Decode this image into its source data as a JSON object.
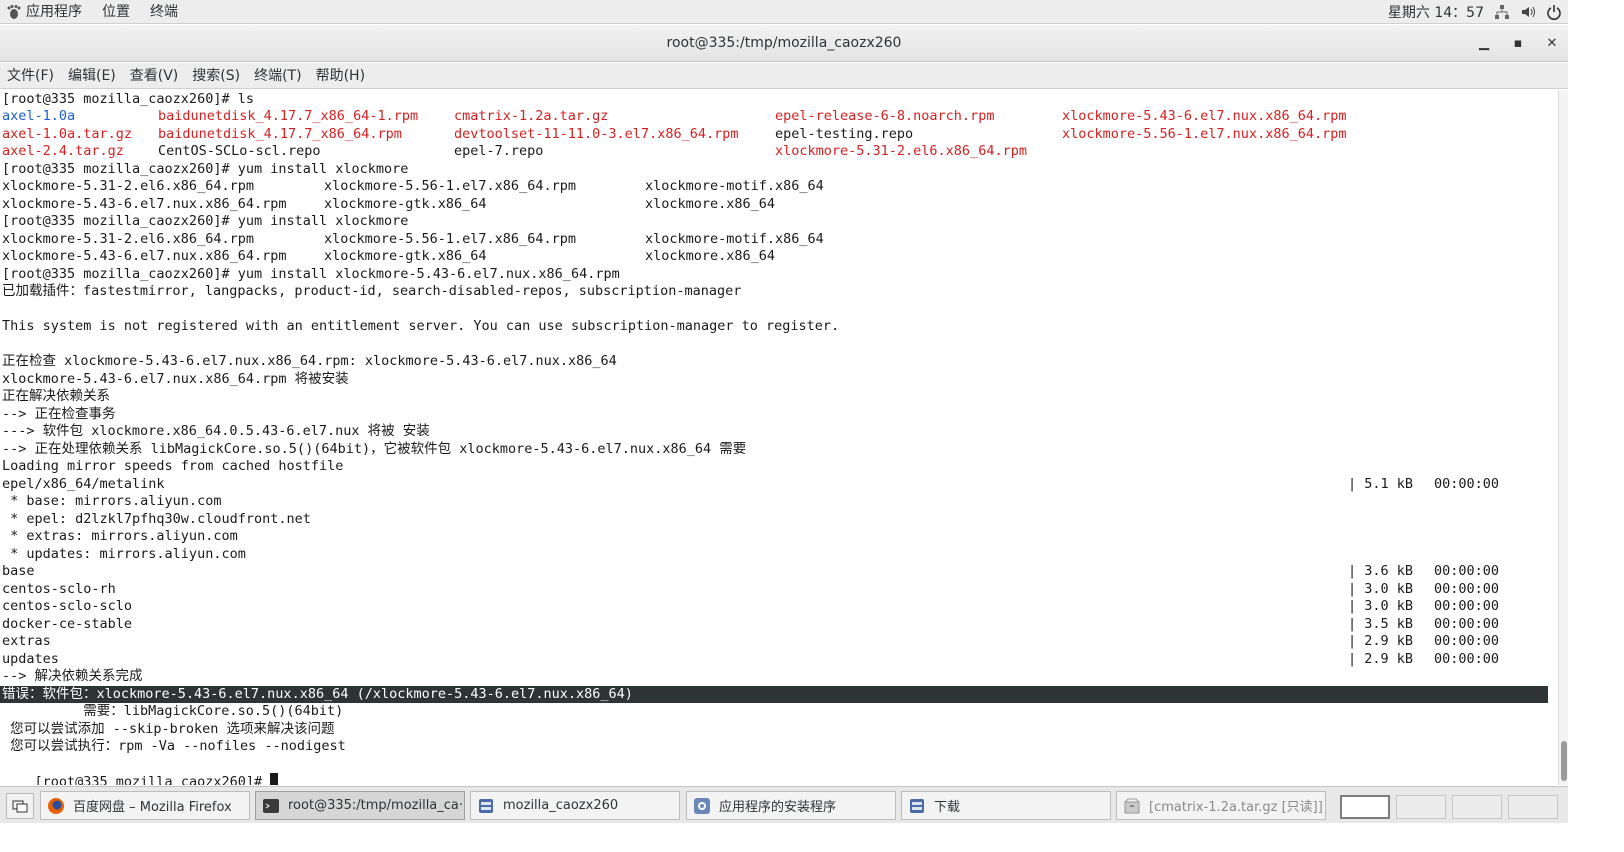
{
  "top_panel": {
    "menu": [
      "应用程序",
      "位置",
      "终端"
    ],
    "clock": "星期六 14：57"
  },
  "window": {
    "title": "root@335:/tmp/mozilla_caozx260",
    "menu": [
      "文件(F)",
      "编辑(E)",
      "查看(V)",
      "搜索(S)",
      "终端(T)",
      "帮助(H)"
    ]
  },
  "terminal": {
    "ls_prompt": "[root@335 mozilla_caozx260]# ls",
    "ls_rows": [
      [
        "axel-1.0a",
        "baidunetdisk_4.17.7_x86_64-1.rpm",
        "cmatrix-1.2a.tar.gz",
        "epel-release-6-8.noarch.rpm",
        "xlockmore-5.43-6.el7.nux.x86_64.rpm"
      ],
      [
        "axel-1.0a.tar.gz",
        "baidunetdisk_4.17.7_x86_64.rpm",
        "devtoolset-11-11.0-3.el7.x86_64.rpm",
        "epel-testing.repo",
        "xlockmore-5.56-1.el7.nux.x86_64.rpm"
      ],
      [
        "axel-2.4.tar.gz",
        "CentOS-SCLo-scl.repo",
        "epel-7.repo",
        "xlockmore-5.31-2.el6.x86_64.rpm",
        ""
      ]
    ],
    "install1_prompt": "[root@335 mozilla_caozx260]# yum install xlockmore",
    "compl_rows": [
      [
        "xlockmore-5.31-2.el6.x86_64.rpm",
        "xlockmore-5.56-1.el7.x86_64.rpm",
        "xlockmore-motif.x86_64"
      ],
      [
        "xlockmore-5.43-6.el7.nux.x86_64.rpm",
        "xlockmore-gtk.x86_64",
        "xlockmore.x86_64"
      ]
    ],
    "install2_prompt": "[root@335 mozilla_caozx260]# yum install xlockmore",
    "install3_prompt": "[root@335 mozilla_caozx260]# yum install xlockmore-5.43-6.el7.nux.x86_64.rpm",
    "out": [
      "已加载插件：fastestmirror, langpacks, product-id, search-disabled-repos, subscription-manager",
      "",
      "This system is not registered with an entitlement server. You can use subscription-manager to register.",
      "",
      "正在检查 xlockmore-5.43-6.el7.nux.x86_64.rpm: xlockmore-5.43-6.el7.nux.x86_64",
      "xlockmore-5.43-6.el7.nux.x86_64.rpm 将被安装",
      "正在解决依赖关系",
      "--> 正在检查事务",
      "---> 软件包 xlockmore.x86_64.0.5.43-6.el7.nux 将被 安装",
      "--> 正在处理依赖关系 libMagickCore.so.5()(64bit)，它被软件包 xlockmore-5.43-6.el7.nux.x86_64 需要",
      "Loading mirror speeds from cached hostfile"
    ],
    "metalink": {
      "name": "epel/x86_64/metalink",
      "size": "| 5.1 kB",
      "time": "00:00:00"
    },
    "mirrors": [
      " * base: mirrors.aliyun.com",
      " * epel: d2lzkl7pfhq30w.cloudfront.net",
      " * extras: mirrors.aliyun.com",
      " * updates: mirrors.aliyun.com"
    ],
    "repos": [
      {
        "name": "base",
        "size": "| 3.6 kB",
        "time": "00:00:00"
      },
      {
        "name": "centos-sclo-rh",
        "size": "| 3.0 kB",
        "time": "00:00:00"
      },
      {
        "name": "centos-sclo-sclo",
        "size": "| 3.0 kB",
        "time": "00:00:00"
      },
      {
        "name": "docker-ce-stable",
        "size": "| 3.5 kB",
        "time": "00:00:00"
      },
      {
        "name": "extras",
        "size": "| 2.9 kB",
        "time": "00:00:00"
      },
      {
        "name": "updates",
        "size": "| 2.9 kB",
        "time": "00:00:00"
      }
    ],
    "done": "--> 解决依赖关系完成",
    "error": "错误：软件包：xlockmore-5.43-6.el7.nux.x86_64 (/xlockmore-5.43-6.el7.nux.x86_64)",
    "requires": "          需要：libMagickCore.so.5()(64bit)",
    "hint1": " 您可以尝试添加 --skip-broken 选项来解决该问题",
    "hint2": " 您可以尝试执行：rpm -Va --nofiles --nodigest",
    "final_prompt": "[root@335 mozilla_caozx260]# "
  },
  "taskbar": {
    "tasks": [
      {
        "label": "百度网盘 – Mozilla Firefox",
        "icon": "firefox-icon"
      },
      {
        "label": "root@335:/tmp/mozilla_ca···",
        "icon": "terminal-icon"
      },
      {
        "label": "mozilla_caozx260",
        "icon": "folder-icon"
      },
      {
        "label": "应用程序的安装程序",
        "icon": "installer-icon"
      },
      {
        "label": "下载",
        "icon": "folder-icon"
      },
      {
        "label": "[cmatrix-1.2a.tar.gz [只读]]",
        "icon": "archive-icon"
      }
    ]
  },
  "colors": {
    "red": "#d62020",
    "blue": "#1a5fd6",
    "highlight": "#2e3436"
  }
}
